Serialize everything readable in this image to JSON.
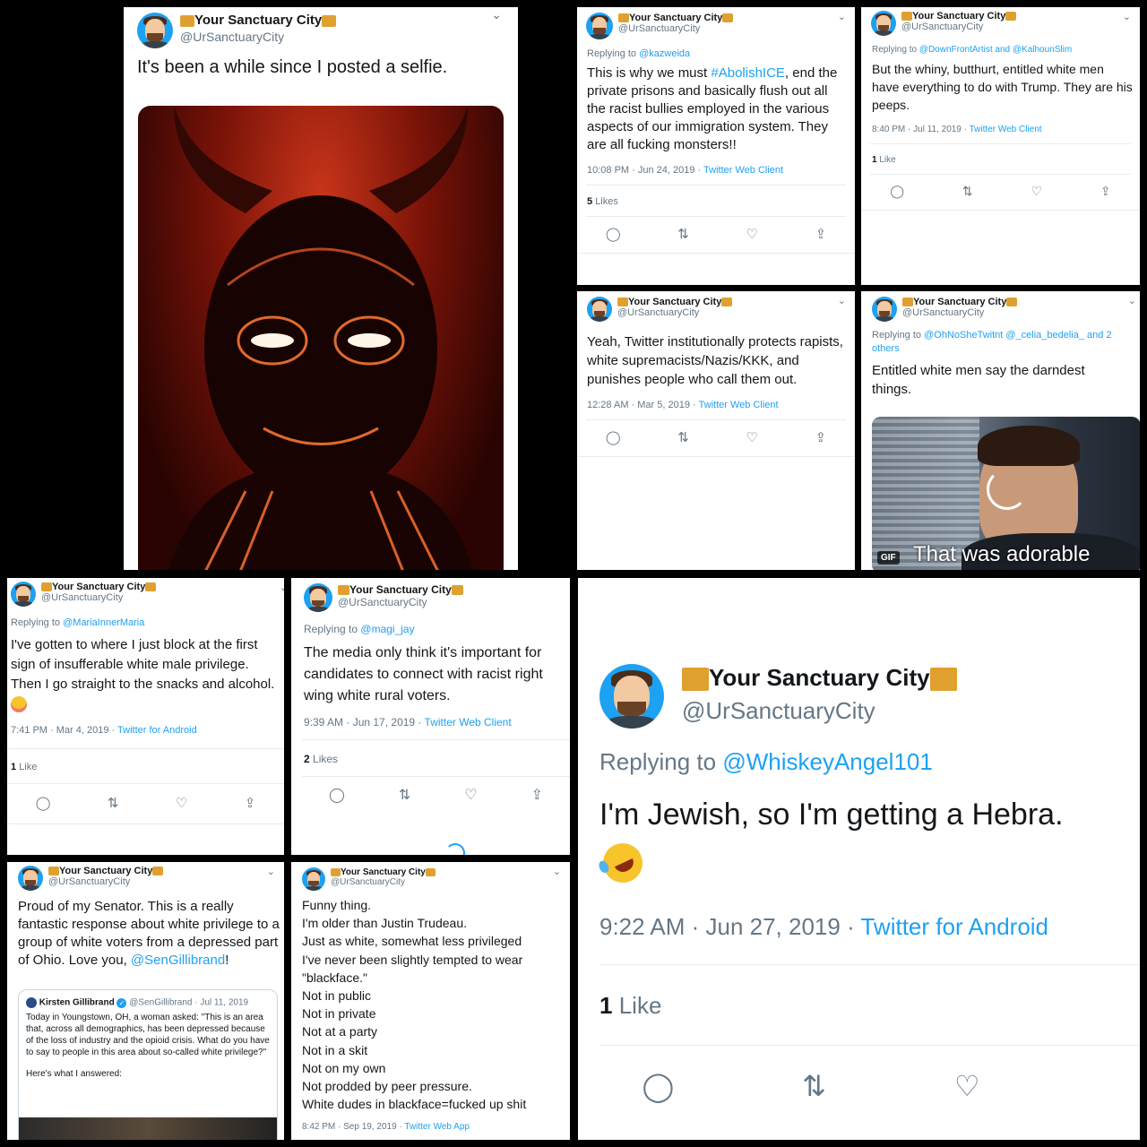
{
  "account": {
    "display_name": "Your Sanctuary City",
    "handle": "@UrSanctuaryCity",
    "avatar_icon": "avatar-illustration-icon",
    "name_emoji_icon": "night-city-icon"
  },
  "actions": {
    "reply_icon": "reply-icon",
    "retweet_icon": "retweet-icon",
    "like_icon": "heart-icon",
    "share_icon": "share-icon"
  },
  "tweets": {
    "t1": {
      "text": "It's been a while since I posted a selfie.",
      "image_icon": "devil-selfie-image"
    },
    "t2": {
      "replying_label": "Replying to",
      "replying_to": "@kazweida",
      "text_pre": "This is why we must ",
      "hashtag": "#AbolishICE",
      "text_post": ", end the private prisons and basically flush out all the racist bullies employed in the various aspects of our immigration system. They are all fucking monsters!!",
      "time": "10:08 PM · Jun 24, 2019 · ",
      "client": "Twitter Web Client",
      "likes_count": "5",
      "likes_label": "Likes"
    },
    "t3": {
      "replying_label": "Replying to",
      "replying_to": "@DownFrontArtist and @KalhounSlim",
      "text": "But the whiny, butthurt, entitled white men have everything to do with Trump. They are his peeps.",
      "time": "8:40 PM · Jul 11, 2019 · ",
      "client": "Twitter Web Client",
      "likes_count": "1",
      "likes_label": "Like"
    },
    "t4": {
      "text": "Yeah, Twitter institutionally protects rapists, white supremacists/Nazis/KKK, and punishes people who call them out.",
      "time": "12:28 AM · Mar 5, 2019 · ",
      "client": "Twitter Web Client"
    },
    "t5": {
      "replying_label": "Replying to",
      "replying_to": "@OhNoSheTwitnt @_celia_bedelia_ and 2 others",
      "text": "Entitled white men say the darndest things.",
      "gif_badge": "GIF",
      "gif_caption": "That was adorable"
    },
    "t6": {
      "replying_label": "Replying to",
      "replying_to": "@MariaInnerMaria",
      "text": "I've gotten to where I just block at the first sign of insufferable white male privilege. Then I go straight to the snacks and alcohol.",
      "emoji_icon": "smiling-face-icon",
      "time": "7:41 PM · Mar 4, 2019 · ",
      "client": "Twitter for Android",
      "likes_count": "1",
      "likes_label": "Like"
    },
    "t7": {
      "replying_label": "Replying to",
      "replying_to": "@magi_jay",
      "text": "The media only think it's important for candidates to connect with racist right wing white rural voters.",
      "time": "9:39 AM · Jun 17, 2019 · ",
      "client": "Twitter Web Client",
      "likes_count": "2",
      "likes_label": "Likes"
    },
    "t8": {
      "replying_label": "Replying to",
      "replying_to": "@WhiskeyAngel101",
      "text": "I'm Jewish, so I'm getting a Hebra.",
      "emoji_icon": "rolling-laughing-face-icon",
      "time": "9:22 AM · Jun 27, 2019 · ",
      "client": "Twitter for Android",
      "likes_count": "1",
      "likes_label": "Like"
    },
    "t9": {
      "text_pre": "Proud of my Senator. This is a really fantastic response about white privilege to a group of white voters from a depressed part of Ohio. Love you, ",
      "mention": "@SenGillibrand",
      "text_post": "!",
      "quote": {
        "name": "Kirsten Gillibrand",
        "handle_time": "@SenGillibrand · Jul 11, 2019",
        "text": "Today in Youngstown, OH, a woman asked: \"This is an area that, across all demographics, has been depressed because of the loss of industry and the opioid crisis. What do you have to say to people in this area about so-called white privilege?\"",
        "text2": "Here's what I answered:"
      }
    },
    "t10": {
      "text": "Funny thing.\nI'm older than Justin Trudeau.\nJust as white, somewhat less privileged\nI've never been slightly tempted to wear \"blackface.\"\nNot in public\nNot in private\nNot at a party\nNot in a skit\nNot on my own\nNot prodded by peer pressure.\nWhite dudes in blackface=fucked up shit",
      "time": "8:42 PM · Sep 19, 2019 · ",
      "client": "Twitter Web App"
    }
  }
}
